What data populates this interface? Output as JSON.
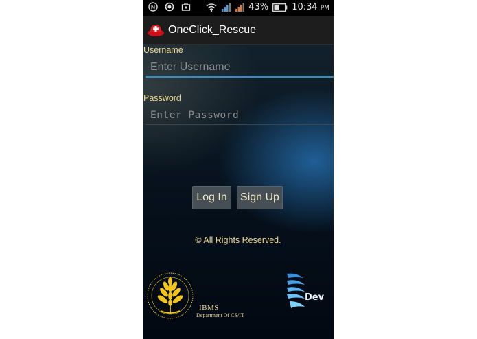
{
  "status_bar": {
    "battery": "43%",
    "time": "10:34",
    "ampm": "PM",
    "icons": [
      "notification-n-icon",
      "record-icon",
      "briefcase-icon",
      "wifi-icon",
      "signal-icon",
      "signal-icon-2",
      "battery-icon"
    ]
  },
  "action_bar": {
    "title": "OneClick_Rescue",
    "icon": "rescue-helmet-icon"
  },
  "form": {
    "username_label": "Username",
    "username_placeholder": "Enter Username",
    "username_value": "",
    "password_label": "Password",
    "password_placeholder": "Enter Password",
    "password_value": ""
  },
  "buttons": {
    "login_label": "Log In",
    "signup_label": "Sign Up"
  },
  "footer": {
    "rights": "© All Rights Reserved.",
    "ibms_title": "IBMS",
    "ibms_dept": "Department Of CS/IT",
    "devs_text": "Devs"
  },
  "colors": {
    "label_text": "#ead890",
    "accent_underline": "#2e8fc9",
    "button_bg": "#454f55",
    "action_bar_bg": "#1d1d1d"
  }
}
